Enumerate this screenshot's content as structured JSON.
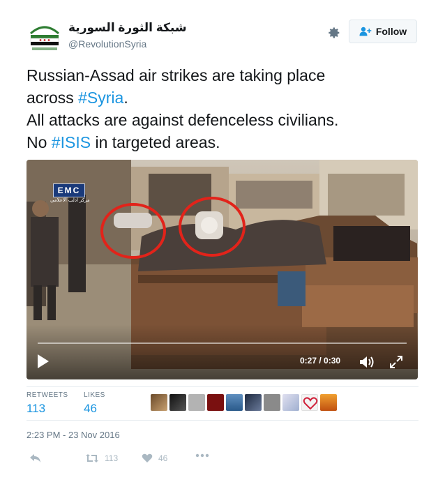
{
  "author": {
    "display_name": "شبكة الثورة السورية",
    "handle": "@RevolutionSyria"
  },
  "follow_button": {
    "label": "Follow"
  },
  "tweet": {
    "line1": "Russian-Assad air strikes are taking place",
    "line2_prefix": "across ",
    "line2_hashtag": "#Syria",
    "line2_suffix": ".",
    "line3": "All attacks are against defenceless civilians.",
    "line4_prefix": "No ",
    "line4_hashtag": "#ISIS",
    "line4_suffix": " in targeted areas."
  },
  "video": {
    "watermark": "EMC",
    "watermark_sub": "مركز ادلب الاعلامي",
    "time": "0:27 / 0:30",
    "progress": 0.9
  },
  "stats": {
    "retweets_label": "RETWEETS",
    "retweets_count": "113",
    "likes_label": "LIKES",
    "likes_count": "46"
  },
  "timestamp": "2:23 PM - 23 Nov 2016",
  "actions": {
    "retweet_count": "113",
    "like_count": "46"
  },
  "colors": {
    "link": "#1b95e0",
    "muted": "#657786",
    "action": "#aab8c2"
  }
}
